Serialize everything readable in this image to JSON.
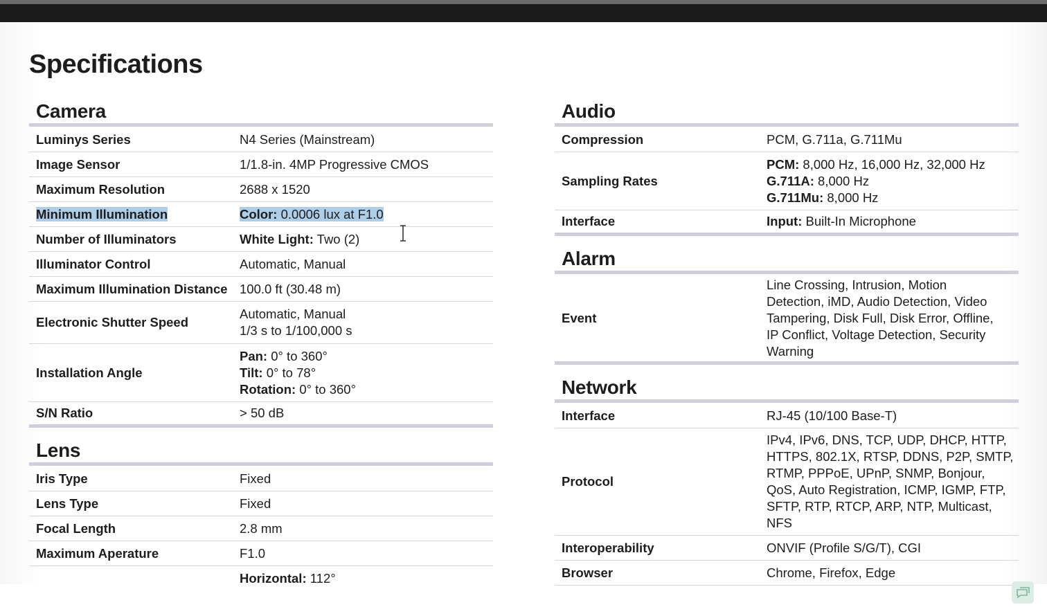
{
  "title": "Specifications",
  "camera": {
    "heading": "Camera",
    "rows": [
      {
        "label": "Luminys Series",
        "value": "N4 Series (Mainstream)"
      },
      {
        "label": "Image Sensor",
        "value": "1/1.8-in. 4MP Progressive CMOS"
      },
      {
        "label": "Maximum Resolution",
        "value": "2688 x 1520"
      },
      {
        "label": "Minimum Illumination",
        "bold": "Color:",
        "value": " 0.0006 lux at F1.0",
        "highlighted": true
      },
      {
        "label": "Number of Illuminators",
        "bold": "White Light:",
        "value": " Two (2)"
      },
      {
        "label": "Illuminator Control",
        "value": "Automatic, Manual"
      },
      {
        "label": "Maximum Illumination Distance",
        "value": "100.0 ft (30.48 m)"
      },
      {
        "label": "Electronic Shutter Speed",
        "lines": [
          "Automatic, Manual",
          "1/3 s to 1/100,000 s"
        ]
      },
      {
        "label": "Installation Angle",
        "lines_bold": [
          {
            "bold": "Pan:",
            "value": " 0° to 360°"
          },
          {
            "bold": "Tilt:",
            "value": " 0° to 78°"
          },
          {
            "bold": "Rotation:",
            "value": " 0° to 360°"
          }
        ]
      },
      {
        "label": "S/N Ratio",
        "value": "> 50 dB"
      }
    ]
  },
  "lens": {
    "heading": "Lens",
    "rows": [
      {
        "label": "Iris Type",
        "value": "Fixed"
      },
      {
        "label": "Lens Type",
        "value": "Fixed"
      },
      {
        "label": "Focal Length",
        "value": "2.8 mm"
      },
      {
        "label": "Maximum Aperature",
        "value": "F1.0"
      },
      {
        "bold": "Horizontal:",
        "value": " 112°"
      }
    ]
  },
  "audio": {
    "heading": "Audio",
    "rows": [
      {
        "label": "Compression",
        "value": "PCM, G.711a, G.711Mu"
      },
      {
        "label": "Sampling Rates",
        "lines_bold": [
          {
            "bold": "PCM:",
            "value": " 8,000 Hz, 16,000 Hz, 32,000 Hz"
          },
          {
            "bold": "G.711A:",
            "value": " 8,000 Hz"
          },
          {
            "bold": "G.711Mu:",
            "value": " 8,000 Hz"
          }
        ]
      },
      {
        "label": "Interface",
        "bold": "Input:",
        "value": " Built-In Microphone"
      }
    ]
  },
  "alarm": {
    "heading": "Alarm",
    "rows": [
      {
        "label": "Event",
        "lines": [
          "Line Crossing, Intrusion, Motion",
          "Detection, iMD, Audio Detection, Video",
          "Tampering, Disk Full, Disk Error, Offline,",
          "IP Conflict, Voltage Detection, Security",
          "Warning"
        ]
      }
    ]
  },
  "network": {
    "heading": "Network",
    "rows": [
      {
        "label": "Interface",
        "value": "RJ-45 (10/100 Base-T)"
      },
      {
        "label": "Protocol",
        "lines": [
          "IPv4, IPv6, DNS, TCP, UDP, DHCP, HTTP,",
          "HTTPS, 802.1X, RTSP, DDNS, P2P, SMTP,",
          "RTMP, PPPoE, UPnP, SNMP, Bonjour,",
          "QoS, Auto Registration, ICMP, IGMP, FTP,",
          "SFTP, RTP, RTCP, ARP, NTP, Multicast,",
          "NFS"
        ]
      },
      {
        "label": "Interoperability",
        "value": "ONVIF (Profile S/G/T), CGI"
      },
      {
        "label": "Browser",
        "value": "Chrome, Firefox, Edge"
      }
    ]
  },
  "icons": {
    "cursor": "text-cursor-icon",
    "corner": "chat-icon"
  },
  "colors": {
    "highlight": "#aecde6",
    "rule": "#cfcfdb"
  }
}
